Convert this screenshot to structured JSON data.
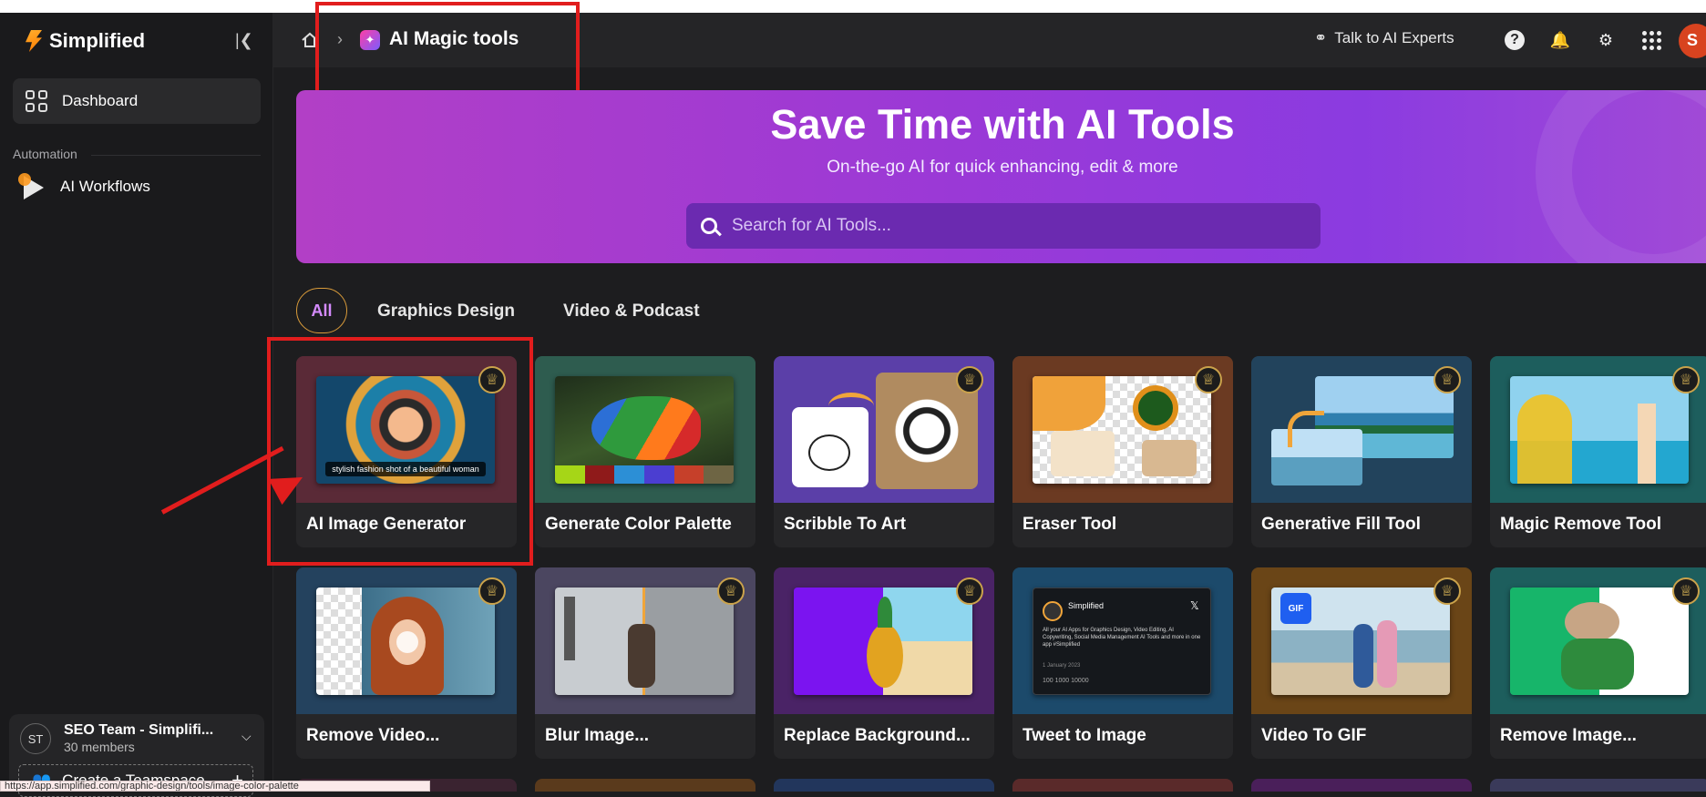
{
  "app": {
    "name": "Simplified"
  },
  "sidebar": {
    "dashboard_label": "Dashboard",
    "section_label": "Automation",
    "workflows_label": "AI Workflows",
    "team": {
      "initials": "ST",
      "name": "SEO Team - Simplifi...",
      "members": "30 members"
    },
    "create_teamspace_label": "Create a Teamspace"
  },
  "status_url": "https://app.simplified.com/graphic-design/tools/image-color-palette",
  "header": {
    "breadcrumb_title": "AI Magic tools",
    "talk_label": "Talk to AI Experts",
    "avatar_initial": "S"
  },
  "hero": {
    "title": "Save Time with AI Tools",
    "subtitle": "On-the-go AI for quick enhancing, edit & more",
    "search_placeholder": "Search for AI Tools..."
  },
  "tabs": [
    "All",
    "Graphics Design",
    "Video & Podcast"
  ],
  "cards_row1": [
    {
      "label": "AI Image Generator",
      "caption": "stylish fashion shot of a beautiful woman",
      "bg": "#5a2a37"
    },
    {
      "label": "Generate Color Palette",
      "bg": "#2e5c4f"
    },
    {
      "label": "Scribble To Art",
      "bg": "#5b3fa8"
    },
    {
      "label": "Eraser Tool",
      "bg": "#6b3a22"
    },
    {
      "label": "Generative Fill Tool",
      "bg": "#22435c"
    },
    {
      "label": "Magic Remove Tool",
      "bg": "#1d5e5d"
    }
  ],
  "cards_row2": [
    {
      "label": "Remove Video...",
      "bg": "#24425e"
    },
    {
      "label": "Blur Image...",
      "bg": "#4b4660"
    },
    {
      "label": "Replace Background...",
      "bg": "#4a2366"
    },
    {
      "label": "Tweet to Image",
      "bg": "#1c4a6b",
      "tweet_name": "Simplified",
      "tweet_text": "All your AI Apps for Graphics Design, Video Editing, AI Copywriting, Social Media Management AI Tools and more in one app #Simplified",
      "tweet_date": "1 January 2023",
      "tweet_stats": "100   1000   10000"
    },
    {
      "label": "Video To GIF",
      "bg": "#6a4517",
      "badge": "GIF"
    },
    {
      "label": "Remove Image...",
      "bg": "#1d5e5d"
    }
  ],
  "colors": {
    "accent": "#d58bff",
    "highlight": "#e11d1d",
    "crown": "#e8c15a"
  }
}
